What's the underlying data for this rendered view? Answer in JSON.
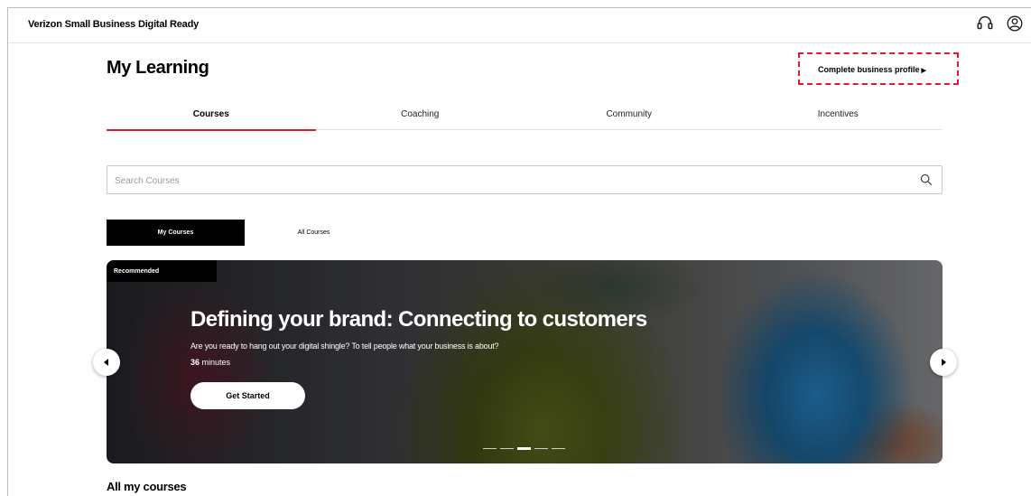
{
  "header": {
    "brand": "Verizon Small Business Digital Ready",
    "icons": [
      "headset-icon",
      "account-icon"
    ]
  },
  "page": {
    "title": "My Learning",
    "profile_link": "Complete business profile"
  },
  "tabs": [
    {
      "label": "Courses",
      "active": true
    },
    {
      "label": "Coaching",
      "active": false
    },
    {
      "label": "Community",
      "active": false
    },
    {
      "label": "Incentives",
      "active": false
    }
  ],
  "search": {
    "placeholder": "Search Courses",
    "value": ""
  },
  "subtabs": [
    {
      "label": "My Courses",
      "active": true
    },
    {
      "label": "All Courses",
      "active": false
    }
  ],
  "hero": {
    "badge": "Recommended",
    "title": "Defining your brand: Connecting to customers",
    "description": "Are you ready to hang out your digital shingle? To tell people what your business is about?",
    "duration_value": "36",
    "duration_unit": "minutes",
    "cta": "Get Started",
    "slide_count": 5,
    "active_slide": 3
  },
  "sections": {
    "all_courses_title": "All my courses"
  },
  "colors": {
    "accent": "#e0182d",
    "dark": "#000000",
    "text": "#000000"
  }
}
